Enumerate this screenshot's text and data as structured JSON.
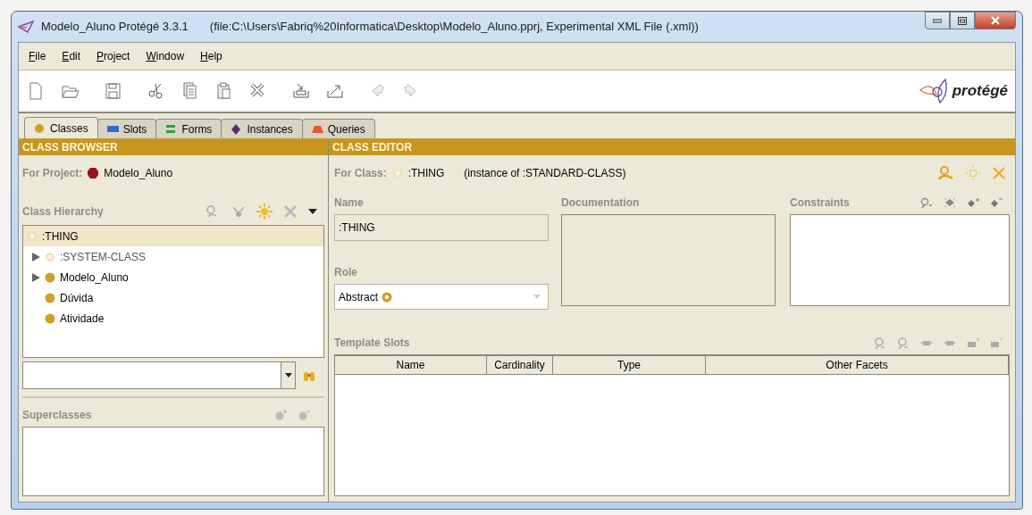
{
  "window": {
    "title": "Modelo_Aluno  Protégé 3.3.1",
    "file": "(file:C:\\Users\\Fabriq%20Informatica\\Desktop\\Modelo_Aluno.pprj, Experimental XML File (.xml))"
  },
  "menu": [
    "File",
    "Edit",
    "Project",
    "Window",
    "Help"
  ],
  "logo": "protégé",
  "tabs": [
    {
      "label": "Classes",
      "selected": true
    },
    {
      "label": "Slots",
      "selected": false
    },
    {
      "label": "Forms",
      "selected": false
    },
    {
      "label": "Instances",
      "selected": false
    },
    {
      "label": "Queries",
      "selected": false
    }
  ],
  "class_browser": {
    "header": "CLASS BROWSER",
    "project_label": "For Project:",
    "project_name": "Modelo_Aluno",
    "hierarchy_label": "Class Hierarchy",
    "tree": [
      {
        "label": ":THING",
        "kind": "system",
        "selected": true,
        "children": [
          {
            "label": ":SYSTEM-CLASS",
            "kind": "system",
            "selected": false,
            "collapsed": true
          },
          {
            "label": "Modelo_Aluno",
            "kind": "class",
            "selected": false,
            "collapsed": true
          },
          {
            "label": "Dúvida",
            "kind": "class",
            "selected": false,
            "collapsed": false
          },
          {
            "label": "Atividade",
            "kind": "class",
            "selected": false,
            "collapsed": false
          }
        ]
      }
    ],
    "superclasses_label": "Superclasses"
  },
  "class_editor": {
    "header": "CLASS EDITOR",
    "for_class_label": "For Class:",
    "class_name": ":THING",
    "instance_of": "(instance of :STANDARD-CLASS)",
    "name_label": "Name",
    "name_value": ":THING",
    "documentation_label": "Documentation",
    "constraints_label": "Constraints",
    "role_label": "Role",
    "role_value": "Abstract",
    "template_slots_label": "Template Slots",
    "columns": [
      "Name",
      "Cardinality",
      "Type",
      "Other Facets"
    ]
  }
}
